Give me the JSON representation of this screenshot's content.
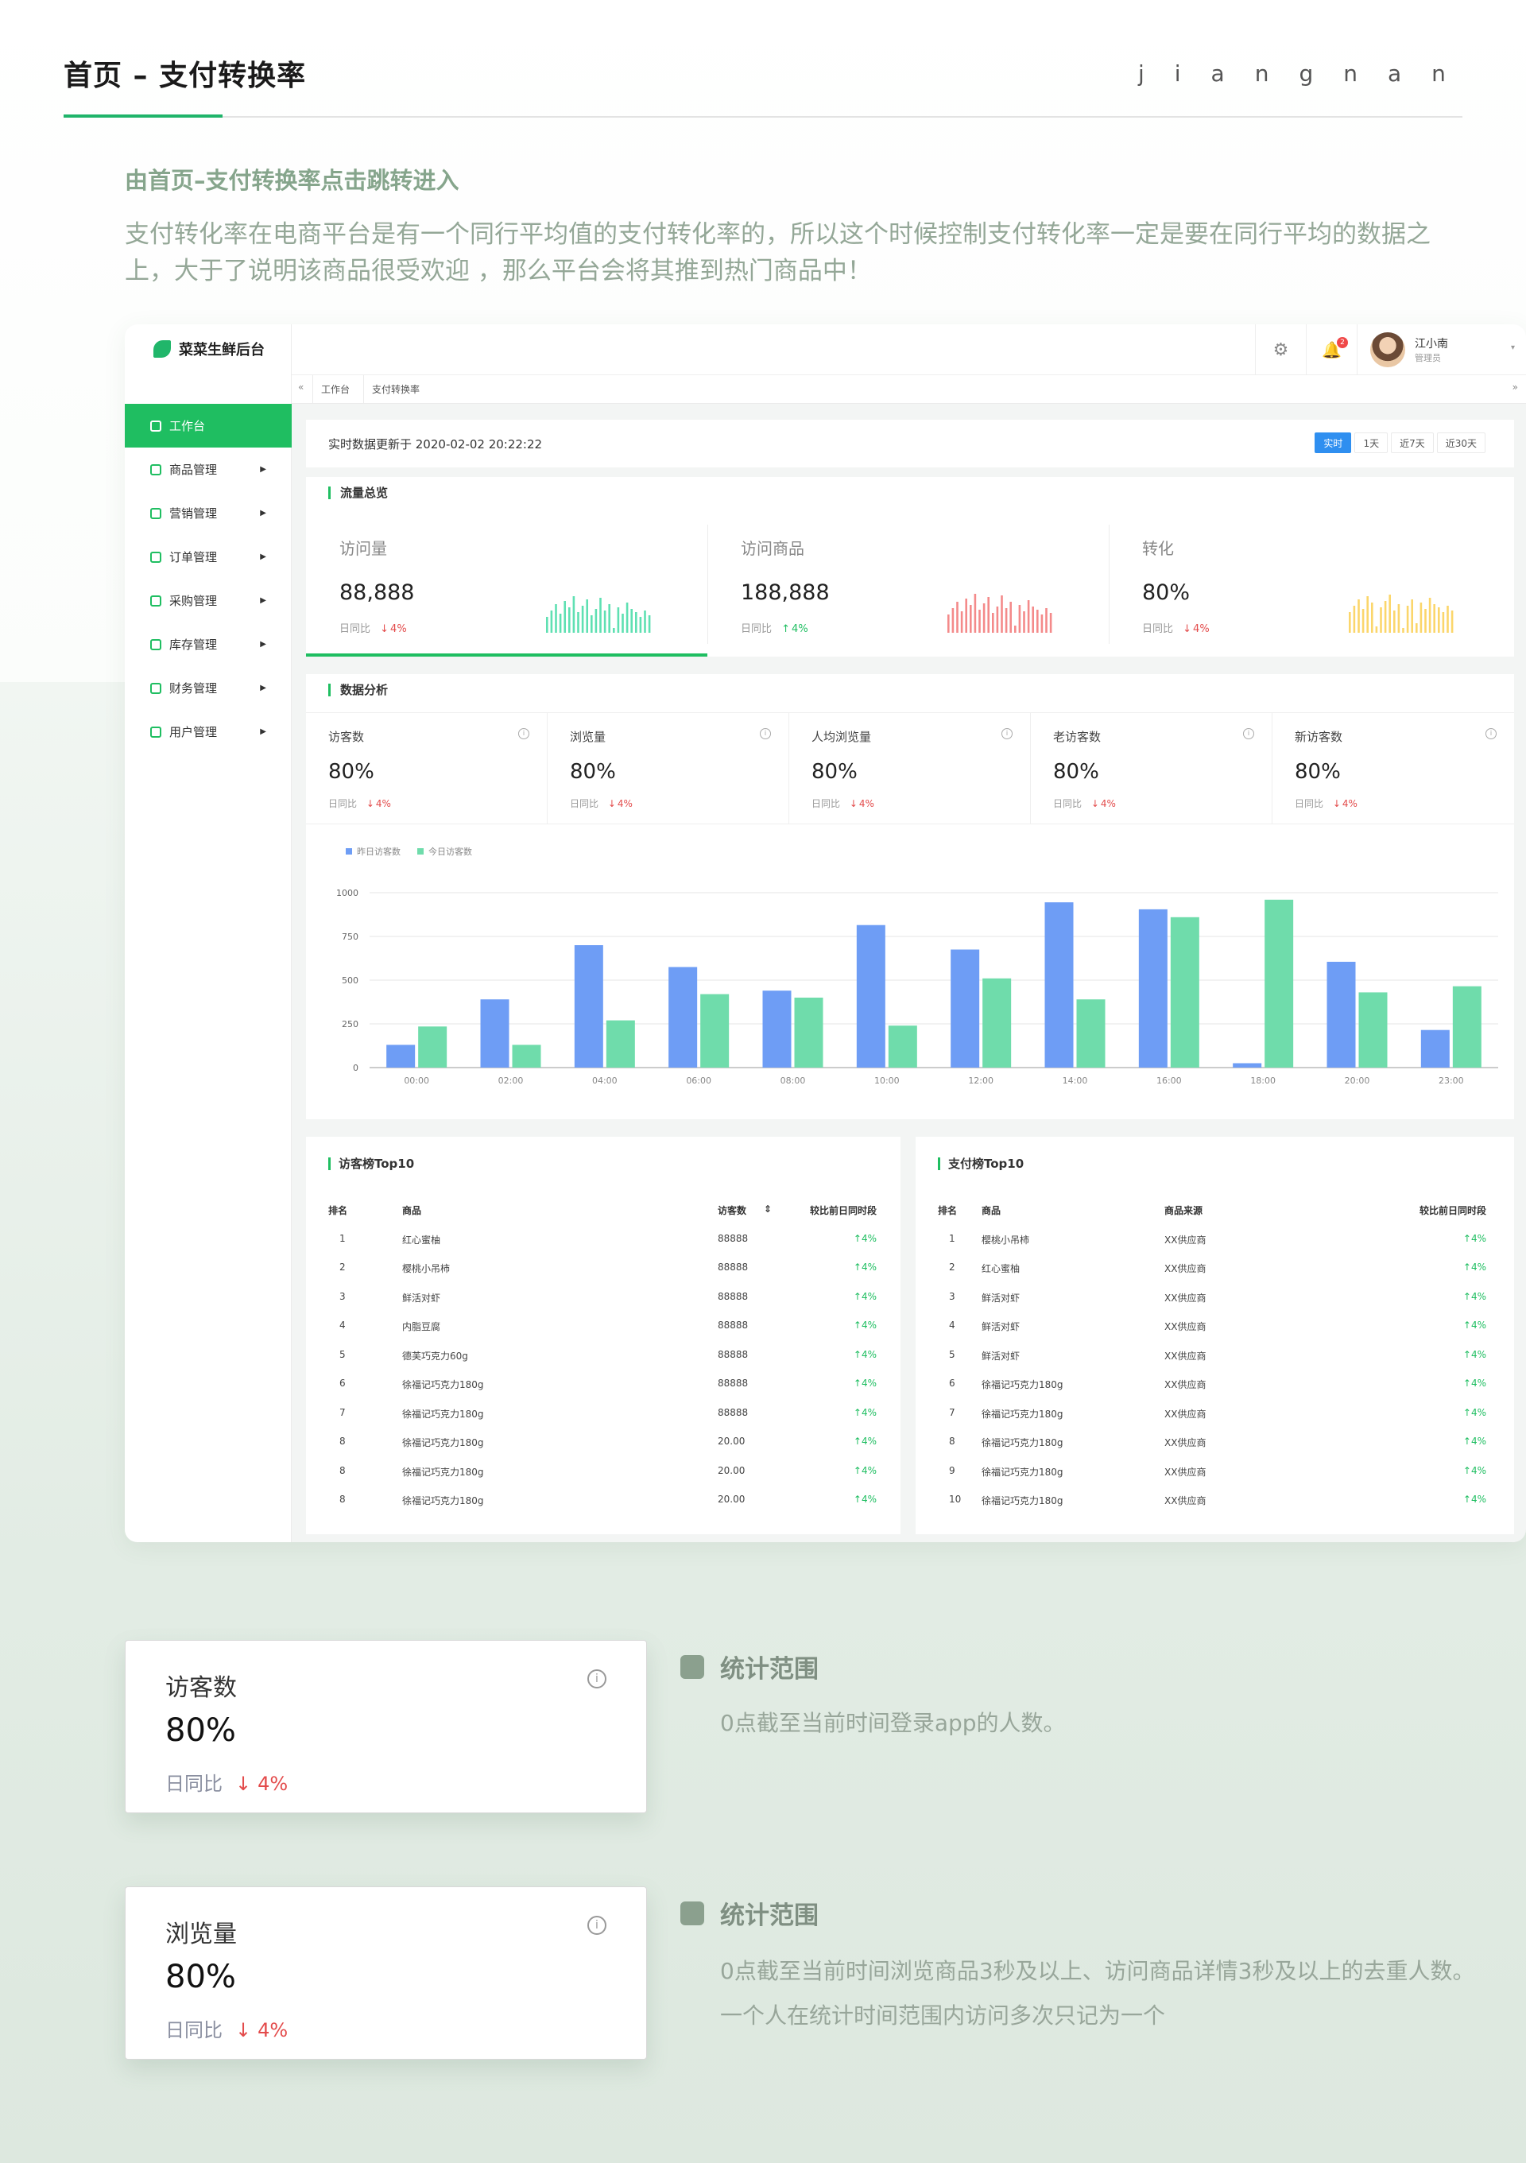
{
  "header": {
    "title": "首页 – 支付转换率",
    "brand": "jiangnan",
    "intro_title": "由首页–支付转换率点击跳转进入",
    "intro_text": "支付转化率在电商平台是有一个同行平均值的支付转化率的，所以这个时候控制支付转化率一定是要在同行平均的数据之上，大于了说明该商品很受欢迎 ，那么平台会将其推到热门商品中！"
  },
  "app": {
    "logo": "菜菜生鲜后台",
    "menu": [
      {
        "label": "工作台",
        "icon": "dashboard-icon",
        "active": true
      },
      {
        "label": "商品管理",
        "icon": "list-icon"
      },
      {
        "label": "营销管理",
        "icon": "bag-icon"
      },
      {
        "label": "订单管理",
        "icon": "order-icon"
      },
      {
        "label": "采购管理",
        "icon": "purchase-icon"
      },
      {
        "label": "库存管理",
        "icon": "inventory-icon"
      },
      {
        "label": "财务管理",
        "icon": "finance-icon"
      },
      {
        "label": "用户管理",
        "icon": "user-icon"
      }
    ],
    "user": {
      "name": "江小南",
      "role": "管理员",
      "notify_count": "2"
    },
    "tabs": [
      "工作台",
      "支付转换率"
    ],
    "realtime_text": "实时数据更新于 2020-02-02 20:22:22",
    "ranges": [
      "实时",
      "1天",
      "近7天",
      "近30天"
    ],
    "traffic": {
      "title": "流量总览",
      "items": [
        {
          "label": "访问量",
          "value": "88,888",
          "compare": "日同比",
          "delta": "4%",
          "direction": "down",
          "color": "#5fe0b2"
        },
        {
          "label": "访问商品",
          "value": "188,888",
          "compare": "日同比",
          "delta": "4%",
          "direction": "up",
          "color": "#f48a8a"
        },
        {
          "label": "转化",
          "value": "80%",
          "compare": "日同比",
          "delta": "4%",
          "direction": "down",
          "color": "#fbd66b"
        }
      ]
    },
    "analysis": {
      "title": "数据分析",
      "metrics": [
        {
          "label": "访客数",
          "value": "80%",
          "compare": "日同比",
          "delta": "4%"
        },
        {
          "label": "浏览量",
          "value": "80%",
          "compare": "日同比",
          "delta": "4%"
        },
        {
          "label": "人均浏览量",
          "value": "80%",
          "compare": "日同比",
          "delta": "4%"
        },
        {
          "label": "老访客数",
          "value": "80%",
          "compare": "日同比",
          "delta": "4%"
        },
        {
          "label": "新访客数",
          "value": "80%",
          "compare": "日同比",
          "delta": "4%"
        }
      ]
    },
    "visitor_top": {
      "title": "访客榜Top10",
      "columns": [
        "排名",
        "商品",
        "访客数",
        "较比前日同时段"
      ],
      "rows": [
        [
          "1",
          "红心蜜柚",
          "88888",
          "4%"
        ],
        [
          "2",
          "樱桃小吊柿",
          "88888",
          "4%"
        ],
        [
          "3",
          "鲜活对虾",
          "88888",
          "4%"
        ],
        [
          "4",
          "内脂豆腐",
          "88888",
          "4%"
        ],
        [
          "5",
          "德芙巧克力60g",
          "88888",
          "4%"
        ],
        [
          "6",
          "徐福记巧克力180g",
          "88888",
          "4%"
        ],
        [
          "7",
          "徐福记巧克力180g",
          "88888",
          "4%"
        ],
        [
          "8",
          "徐福记巧克力180g",
          "20.00",
          "4%"
        ],
        [
          "8",
          "徐福记巧克力180g",
          "20.00",
          "4%"
        ],
        [
          "8",
          "徐福记巧克力180g",
          "20.00",
          "4%"
        ]
      ]
    },
    "pay_top": {
      "title": "支付榜Top10",
      "columns": [
        "排名",
        "商品",
        "商品来源",
        "较比前日同时段"
      ],
      "rows": [
        [
          "1",
          "樱桃小吊柿",
          "XX供应商",
          "4%"
        ],
        [
          "2",
          "红心蜜柚",
          "XX供应商",
          "4%"
        ],
        [
          "3",
          "鲜活对虾",
          "XX供应商",
          "4%"
        ],
        [
          "4",
          "鲜活对虾",
          "XX供应商",
          "4%"
        ],
        [
          "5",
          "鲜活对虾",
          "XX供应商",
          "4%"
        ],
        [
          "6",
          "徐福记巧克力180g",
          "XX供应商",
          "4%"
        ],
        [
          "7",
          "徐福记巧克力180g",
          "XX供应商",
          "4%"
        ],
        [
          "8",
          "徐福记巧克力180g",
          "XX供应商",
          "4%"
        ],
        [
          "9",
          "徐福记巧克力180g",
          "XX供应商",
          "4%"
        ],
        [
          "10",
          "徐福记巧克力180g",
          "XX供应商",
          "4%"
        ]
      ]
    }
  },
  "chart_data": {
    "type": "bar",
    "categories": [
      "00:00",
      "02:00",
      "04:00",
      "06:00",
      "08:00",
      "10:00",
      "12:00",
      "14:00",
      "16:00",
      "18:00",
      "20:00",
      "23:00"
    ],
    "series": [
      {
        "name": "昨日访客数",
        "color": "#6e9df5",
        "values": [
          130,
          390,
          700,
          575,
          440,
          815,
          675,
          945,
          905,
          25,
          605,
          215
        ]
      },
      {
        "name": "今日访客数",
        "color": "#6fdcab",
        "values": [
          235,
          130,
          270,
          420,
          400,
          240,
          510,
          390,
          860,
          960,
          430,
          465
        ]
      }
    ],
    "ylim": [
      0,
      1000
    ],
    "yticks": [
      0,
      250,
      500,
      750,
      1000
    ],
    "legend": "top-left",
    "grid": true
  },
  "explain": [
    {
      "label": "访客数",
      "value": "80%",
      "compare": "日同比",
      "delta": "4%",
      "head": "统计范围",
      "text": "0点截至当前时间登录app的人数。"
    },
    {
      "label": "浏览量",
      "value": "80%",
      "compare": "日同比",
      "delta": "4%",
      "head": "统计范围",
      "text": "0点截至当前时间浏览商品3秒及以上、访问商品详情3秒及以上的去重人数。一个人在统计时间范围内访问多次只记为一个"
    }
  ]
}
